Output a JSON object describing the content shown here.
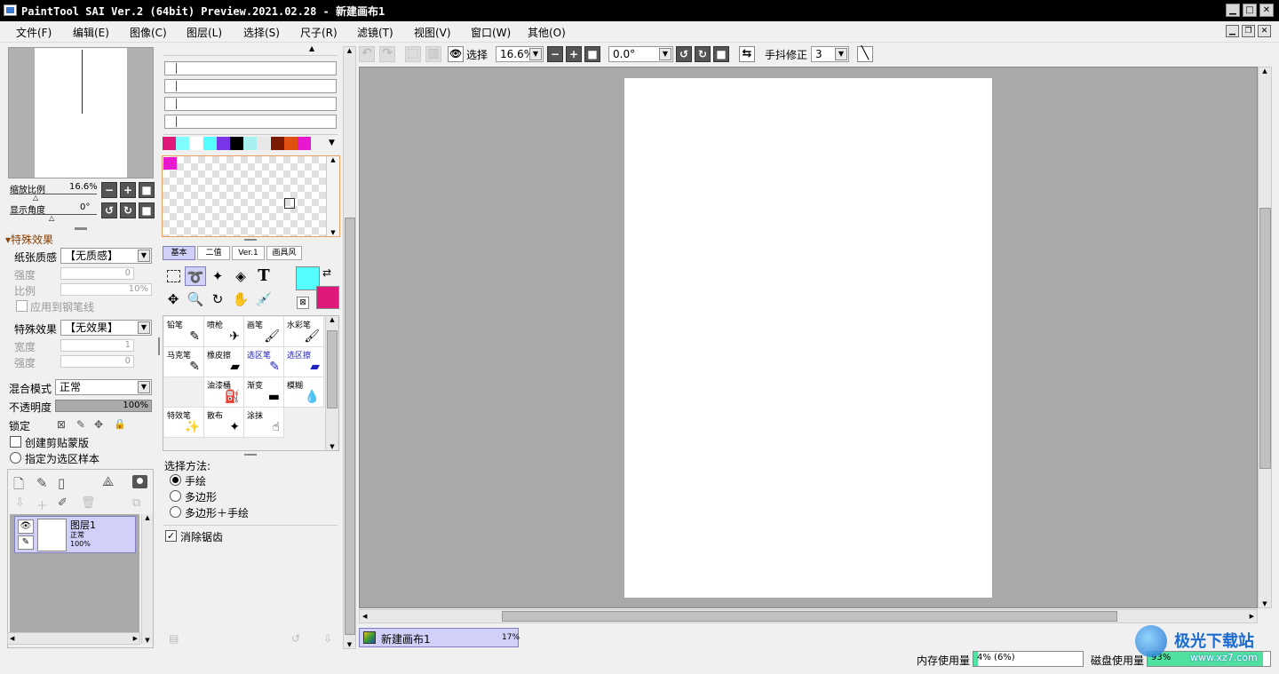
{
  "window": {
    "title": "PaintTool SAI Ver.2 (64bit) Preview.2021.02.28 - 新建画布1",
    "minimize": "▁",
    "maximize": "□",
    "close": "✕"
  },
  "menu": [
    "文件(F)",
    "编辑(E)",
    "图像(C)",
    "图层(L)",
    "选择(S)",
    "尺子(R)",
    "滤镜(T)",
    "视图(V)",
    "窗口(W)",
    "其他(O)"
  ],
  "mdi": {
    "min": "▁",
    "restore": "❐",
    "close": "✕"
  },
  "navigator": {
    "zoom_label": "缩放比例",
    "zoom_value": "16.6%",
    "angle_label": "显示角度",
    "angle_value": "0°"
  },
  "effects": {
    "header": "特殊效果",
    "paper_label": "纸张质感",
    "paper_value": "【无质感】",
    "strength_label": "强度",
    "strength_value": "0",
    "scale_label": "比例",
    "scale_value": "10%",
    "apply_pen": "应用到钢笔线",
    "effect_label": "特殊效果",
    "effect_value": "【无效果】",
    "width_label": "宽度",
    "width_value": "1",
    "strength2_label": "强度",
    "strength2_value": "0"
  },
  "layer_props": {
    "blend_label": "混合模式",
    "blend_value": "正常",
    "opacity_label": "不透明度",
    "opacity_value": "100%",
    "lock_label": "锁定",
    "clip_label": "创建剪贴蒙版",
    "sample_label": "指定为选区样本"
  },
  "layers": [
    {
      "name": "图层1",
      "mode": "正常",
      "opacity": "100%"
    }
  ],
  "palette": {
    "colors": [
      "#e0187a",
      "#7fffff",
      "#ffffff",
      "#55ffff",
      "#7a35e8",
      "#000000",
      "#a8f0f0",
      "#e8e8e8",
      "#7a1a00",
      "#e05010",
      "#e818d0",
      "#f0f0f0"
    ]
  },
  "scratch": {
    "color": "#e818d0"
  },
  "tool_tabs": [
    "基本",
    "二值",
    "Ver.1",
    "画具风"
  ],
  "colors": {
    "fg": "#55ffff",
    "bg": "#e0187a",
    "accent": "#d0d0f8"
  },
  "tools": [
    "selection-rect",
    "lasso",
    "magic-wand",
    "shape",
    "text",
    "move",
    "zoom",
    "rotate",
    "hand",
    "eyedropper"
  ],
  "tool_text_glyph": "T",
  "brushes": [
    {
      "name": "铅笔",
      "icon": "✎"
    },
    {
      "name": "喷枪",
      "icon": "✈"
    },
    {
      "name": "画笔",
      "icon": "🖌"
    },
    {
      "name": "水彩笔",
      "icon": "🖌"
    },
    {
      "name": "马克笔",
      "icon": "✎"
    },
    {
      "name": "橡皮擦",
      "icon": "▰"
    },
    {
      "name": "选区笔",
      "icon": "✎"
    },
    {
      "name": "选区擦",
      "icon": "▰"
    },
    {
      "name": "",
      "icon": ""
    },
    {
      "name": "油漆桶",
      "icon": "⛽"
    },
    {
      "name": "渐变",
      "icon": "▬"
    },
    {
      "name": "模糊",
      "icon": "💧"
    },
    {
      "name": "特效笔",
      "icon": "✨"
    },
    {
      "name": "散布",
      "icon": "✦"
    },
    {
      "name": "涂抹",
      "icon": "☝"
    }
  ],
  "select_method": {
    "label": "选择方法:",
    "options": [
      "手绘",
      "多边形",
      "多边形＋手绘"
    ],
    "selected": 0,
    "antialias": "消除锯齿"
  },
  "toolbar": {
    "select_label": "选择",
    "zoom": "16.6%",
    "angle": "0.0°",
    "stabilizer_label": "手抖修正",
    "stabilizer_value": "3"
  },
  "canvas_tab": {
    "name": "新建画布1",
    "percent": "17%"
  },
  "status": {
    "mem_label": "内存使用量",
    "mem_value": "4% (6%)",
    "disk_label": "磁盘使用量",
    "disk_value": "93%"
  },
  "watermark": {
    "text": "极光下载站",
    "url": "www.xz7.com"
  }
}
